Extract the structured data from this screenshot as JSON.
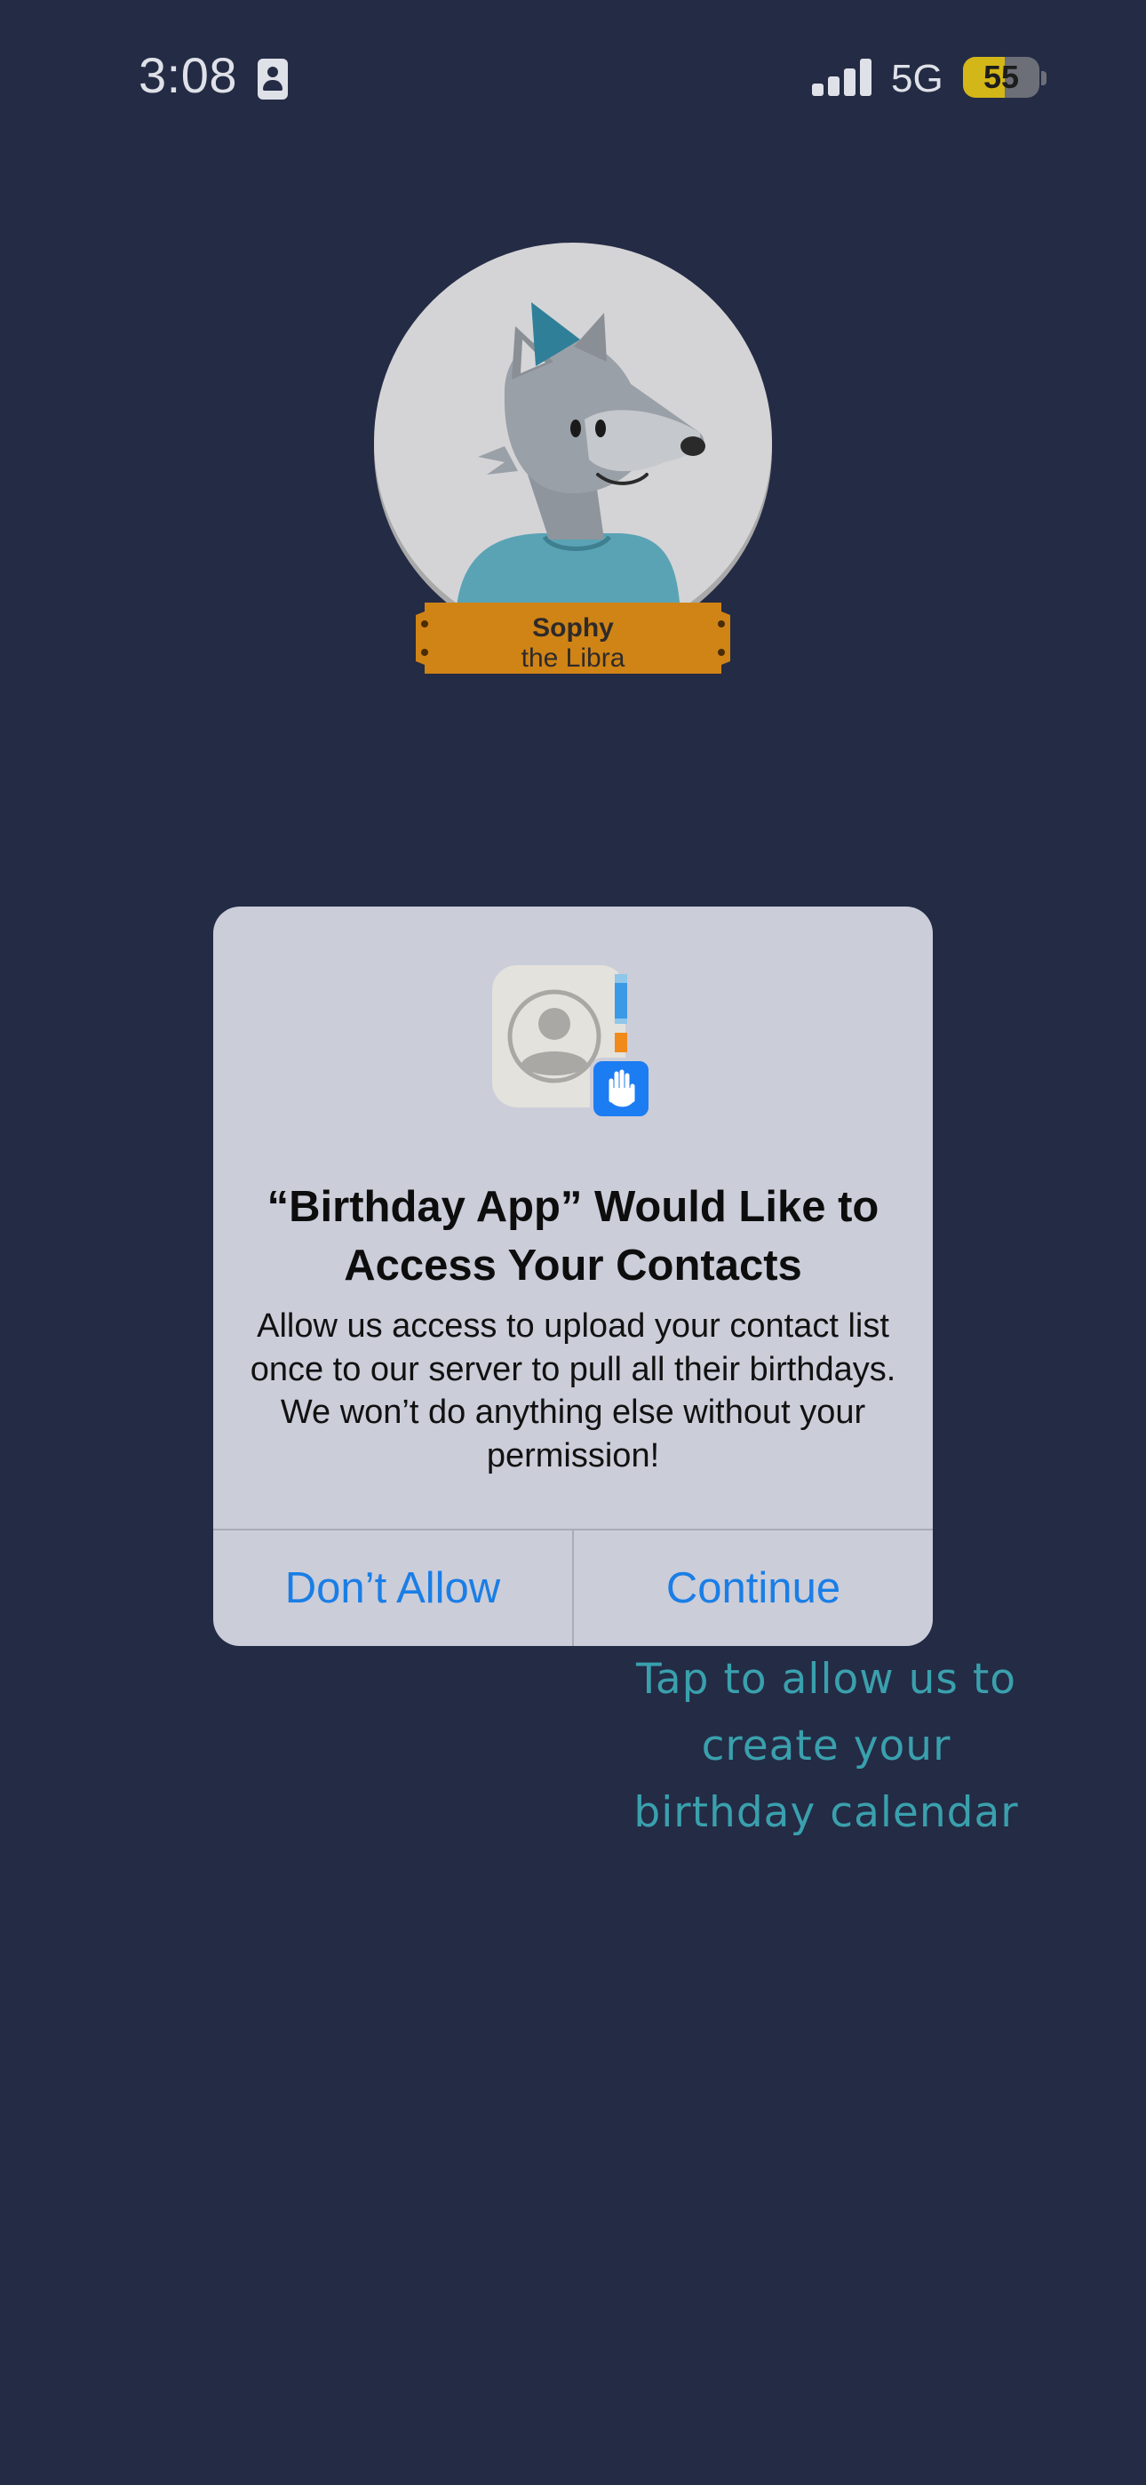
{
  "status_bar": {
    "time": "3:08",
    "network": "5G",
    "battery_level": "55",
    "battery_fraction": 0.55,
    "contact_icon": "contact-card-icon",
    "signal_icon": "cellular-signal-icon"
  },
  "mascot": {
    "name": "Sophy",
    "subtitle": "the Libra",
    "icon": "wolf-party-hat-avatar"
  },
  "alert": {
    "app_icon": "contacts-app-icon",
    "badge_icon": "raised-hand-icon",
    "title": "“Birthday App” Would Like to Access Your Contacts",
    "message": "Allow us access to upload your contact list once to our server to pull all their birthdays. We won’t do anything else without your permission!",
    "dont_allow_label": "Don’t Allow",
    "continue_label": "Continue"
  },
  "hint": {
    "text": "Tap to allow us to create your birthday calendar"
  },
  "colors": {
    "background": "#242b45",
    "alert_bg": "#cbcdd9",
    "button_blue": "#1a7ee6",
    "hint_teal": "#3aa0ad",
    "plate_orange": "#d08415"
  }
}
